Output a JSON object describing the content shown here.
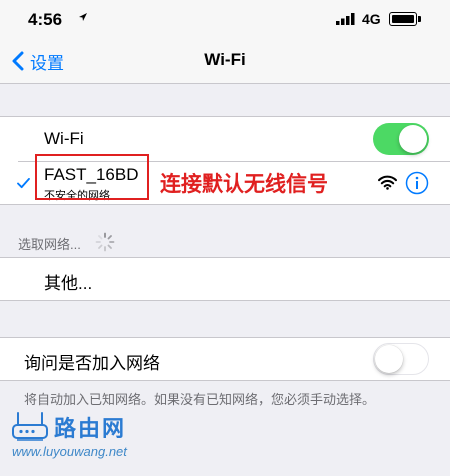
{
  "status_bar": {
    "time": "4:56",
    "location_icon": "location-arrow-icon",
    "network": "4G",
    "signal_icon": "cellular-signal-icon",
    "battery_icon": "battery-icon"
  },
  "nav": {
    "back_label": "设置",
    "title": "Wi-Fi",
    "back_icon": "chevron-left-icon"
  },
  "wifi": {
    "toggle_label": "Wi-Fi",
    "enabled": true,
    "toggle_color": "#4cd964",
    "current_network": {
      "name": "FAST_16BD",
      "security_note": "不安全的网络",
      "checkmark_icon": "checkmark-icon",
      "signal_icon": "wifi-signal-icon",
      "info_icon": "info-icon"
    }
  },
  "annotation": {
    "text": "连接默认无线信号",
    "color": "#e02020"
  },
  "choose_network": {
    "label": "选取网络...",
    "spinner_icon": "loading-spinner-icon"
  },
  "other_network": {
    "label": "其他..."
  },
  "ask_to_join": {
    "label": "询问是否加入网络",
    "enabled": false
  },
  "footer": {
    "text": "将自动加入已知网络。如果没有已知网络，您必须手动选择。"
  },
  "watermark": {
    "brand": "路由网",
    "url": "www.luyouwang.net",
    "logo_icon": "router-logo-icon"
  },
  "colors": {
    "accent": "#007aff",
    "background": "#efeff4"
  }
}
